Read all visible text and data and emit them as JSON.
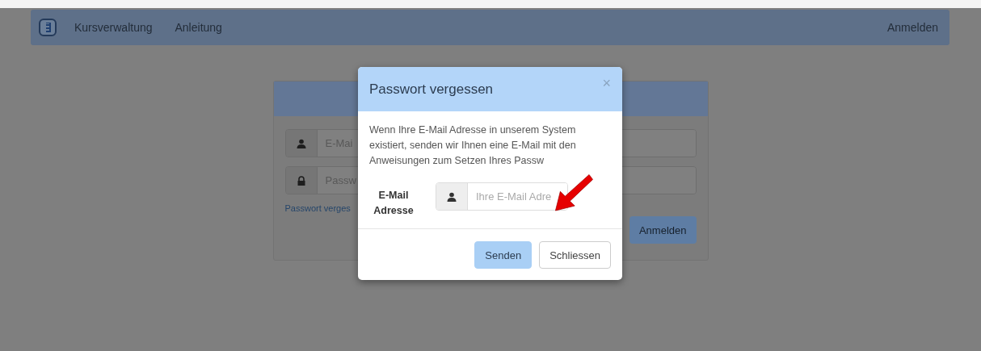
{
  "navbar": {
    "links": [
      {
        "label": "Kursverwaltung"
      },
      {
        "label": "Anleitung"
      }
    ],
    "right_link": "Anmelden"
  },
  "login_panel": {
    "email_placeholder": "E-Mai",
    "password_placeholder": "Passw",
    "forgot_link": "Passwort verges",
    "submit": "Anmelden"
  },
  "modal": {
    "title": "Passwort vergessen",
    "close": "×",
    "message": "Wenn Ihre E-Mail Adresse in unserem System existiert, senden wir Ihnen eine E-Mail mit den Anweisungen zum Setzen Ihres Passw",
    "field_label": "E-Mail Adresse",
    "field_placeholder": "Ihre E-Mail Adre",
    "buttons": [
      {
        "label": "Senden",
        "kind": "primary"
      },
      {
        "label": "Schliessen",
        "kind": "default"
      }
    ]
  }
}
